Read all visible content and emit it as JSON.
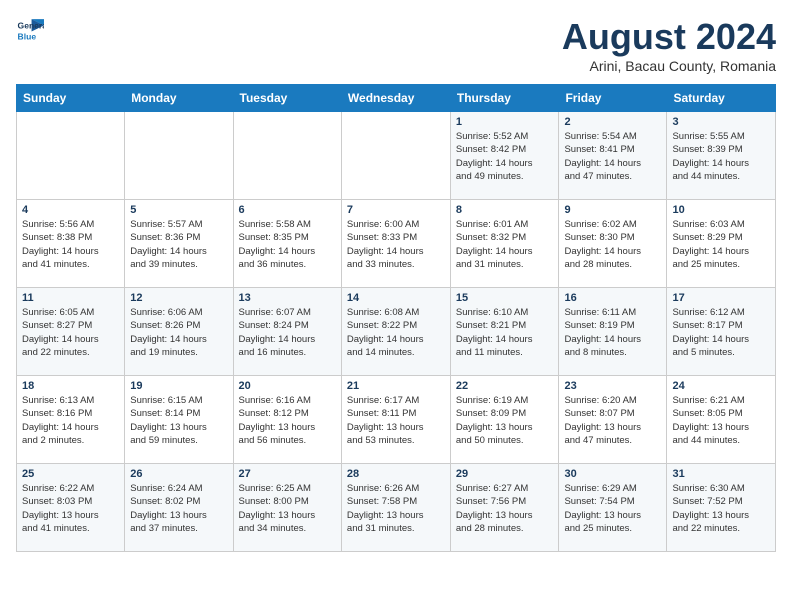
{
  "logo": {
    "line1": "General",
    "line2": "Blue"
  },
  "title": "August 2024",
  "location": "Arini, Bacau County, Romania",
  "headers": [
    "Sunday",
    "Monday",
    "Tuesday",
    "Wednesday",
    "Thursday",
    "Friday",
    "Saturday"
  ],
  "weeks": [
    [
      {
        "day": "",
        "info": ""
      },
      {
        "day": "",
        "info": ""
      },
      {
        "day": "",
        "info": ""
      },
      {
        "day": "",
        "info": ""
      },
      {
        "day": "1",
        "info": "Sunrise: 5:52 AM\nSunset: 8:42 PM\nDaylight: 14 hours\nand 49 minutes."
      },
      {
        "day": "2",
        "info": "Sunrise: 5:54 AM\nSunset: 8:41 PM\nDaylight: 14 hours\nand 47 minutes."
      },
      {
        "day": "3",
        "info": "Sunrise: 5:55 AM\nSunset: 8:39 PM\nDaylight: 14 hours\nand 44 minutes."
      }
    ],
    [
      {
        "day": "4",
        "info": "Sunrise: 5:56 AM\nSunset: 8:38 PM\nDaylight: 14 hours\nand 41 minutes."
      },
      {
        "day": "5",
        "info": "Sunrise: 5:57 AM\nSunset: 8:36 PM\nDaylight: 14 hours\nand 39 minutes."
      },
      {
        "day": "6",
        "info": "Sunrise: 5:58 AM\nSunset: 8:35 PM\nDaylight: 14 hours\nand 36 minutes."
      },
      {
        "day": "7",
        "info": "Sunrise: 6:00 AM\nSunset: 8:33 PM\nDaylight: 14 hours\nand 33 minutes."
      },
      {
        "day": "8",
        "info": "Sunrise: 6:01 AM\nSunset: 8:32 PM\nDaylight: 14 hours\nand 31 minutes."
      },
      {
        "day": "9",
        "info": "Sunrise: 6:02 AM\nSunset: 8:30 PM\nDaylight: 14 hours\nand 28 minutes."
      },
      {
        "day": "10",
        "info": "Sunrise: 6:03 AM\nSunset: 8:29 PM\nDaylight: 14 hours\nand 25 minutes."
      }
    ],
    [
      {
        "day": "11",
        "info": "Sunrise: 6:05 AM\nSunset: 8:27 PM\nDaylight: 14 hours\nand 22 minutes."
      },
      {
        "day": "12",
        "info": "Sunrise: 6:06 AM\nSunset: 8:26 PM\nDaylight: 14 hours\nand 19 minutes."
      },
      {
        "day": "13",
        "info": "Sunrise: 6:07 AM\nSunset: 8:24 PM\nDaylight: 14 hours\nand 16 minutes."
      },
      {
        "day": "14",
        "info": "Sunrise: 6:08 AM\nSunset: 8:22 PM\nDaylight: 14 hours\nand 14 minutes."
      },
      {
        "day": "15",
        "info": "Sunrise: 6:10 AM\nSunset: 8:21 PM\nDaylight: 14 hours\nand 11 minutes."
      },
      {
        "day": "16",
        "info": "Sunrise: 6:11 AM\nSunset: 8:19 PM\nDaylight: 14 hours\nand 8 minutes."
      },
      {
        "day": "17",
        "info": "Sunrise: 6:12 AM\nSunset: 8:17 PM\nDaylight: 14 hours\nand 5 minutes."
      }
    ],
    [
      {
        "day": "18",
        "info": "Sunrise: 6:13 AM\nSunset: 8:16 PM\nDaylight: 14 hours\nand 2 minutes."
      },
      {
        "day": "19",
        "info": "Sunrise: 6:15 AM\nSunset: 8:14 PM\nDaylight: 13 hours\nand 59 minutes."
      },
      {
        "day": "20",
        "info": "Sunrise: 6:16 AM\nSunset: 8:12 PM\nDaylight: 13 hours\nand 56 minutes."
      },
      {
        "day": "21",
        "info": "Sunrise: 6:17 AM\nSunset: 8:11 PM\nDaylight: 13 hours\nand 53 minutes."
      },
      {
        "day": "22",
        "info": "Sunrise: 6:19 AM\nSunset: 8:09 PM\nDaylight: 13 hours\nand 50 minutes."
      },
      {
        "day": "23",
        "info": "Sunrise: 6:20 AM\nSunset: 8:07 PM\nDaylight: 13 hours\nand 47 minutes."
      },
      {
        "day": "24",
        "info": "Sunrise: 6:21 AM\nSunset: 8:05 PM\nDaylight: 13 hours\nand 44 minutes."
      }
    ],
    [
      {
        "day": "25",
        "info": "Sunrise: 6:22 AM\nSunset: 8:03 PM\nDaylight: 13 hours\nand 41 minutes."
      },
      {
        "day": "26",
        "info": "Sunrise: 6:24 AM\nSunset: 8:02 PM\nDaylight: 13 hours\nand 37 minutes."
      },
      {
        "day": "27",
        "info": "Sunrise: 6:25 AM\nSunset: 8:00 PM\nDaylight: 13 hours\nand 34 minutes."
      },
      {
        "day": "28",
        "info": "Sunrise: 6:26 AM\nSunset: 7:58 PM\nDaylight: 13 hours\nand 31 minutes."
      },
      {
        "day": "29",
        "info": "Sunrise: 6:27 AM\nSunset: 7:56 PM\nDaylight: 13 hours\nand 28 minutes."
      },
      {
        "day": "30",
        "info": "Sunrise: 6:29 AM\nSunset: 7:54 PM\nDaylight: 13 hours\nand 25 minutes."
      },
      {
        "day": "31",
        "info": "Sunrise: 6:30 AM\nSunset: 7:52 PM\nDaylight: 13 hours\nand 22 minutes."
      }
    ]
  ]
}
